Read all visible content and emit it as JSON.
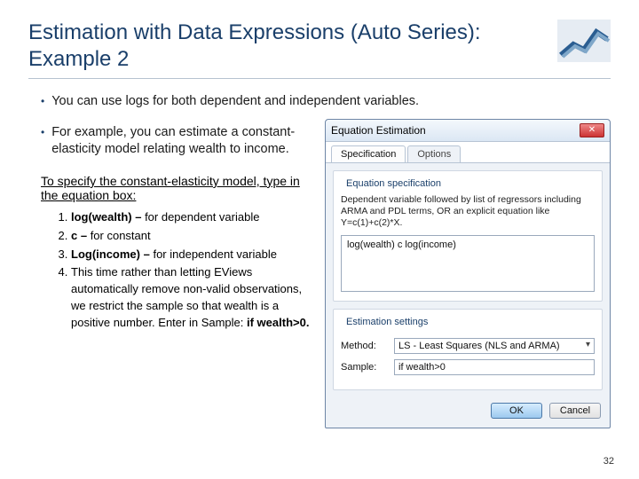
{
  "title": "Estimation with Data Expressions (Auto Series): Example 2",
  "bullets": {
    "b1": "You can use logs for both dependent and independent variables.",
    "b2": "For example, you can estimate a constant-elasticity model relating wealth to income."
  },
  "instruction_heading": "To specify the constant-elasticity model, type in the equation box:",
  "steps": {
    "s1b": "log(wealth) –",
    "s1r": " for  dependent variable",
    "s2b": "c –",
    "s2r": " for constant",
    "s3b": "Log(income) –",
    "s3r": " for independent variable",
    "s4": "This time rather than letting EViews automatically remove non-valid observations, we restrict the sample so that wealth is a positive number. Enter in Sample: ",
    "s4b": "if wealth>0."
  },
  "dialog": {
    "title": "Equation Estimation",
    "tabs": {
      "spec": "Specification",
      "opts": "Options"
    },
    "group_eq": "Equation specification",
    "hint": "Dependent variable followed by list of regressors including ARMA and PDL terms, OR an explicit equation like Y=c(1)+c(2)*X.",
    "equation": "log(wealth) c log(income)",
    "group_est": "Estimation settings",
    "method_label": "Method:",
    "method_value": "LS - Least Squares (NLS and ARMA)",
    "sample_label": "Sample:",
    "sample_value": "if wealth>0",
    "ok": "OK",
    "cancel": "Cancel"
  },
  "page_number": "32"
}
